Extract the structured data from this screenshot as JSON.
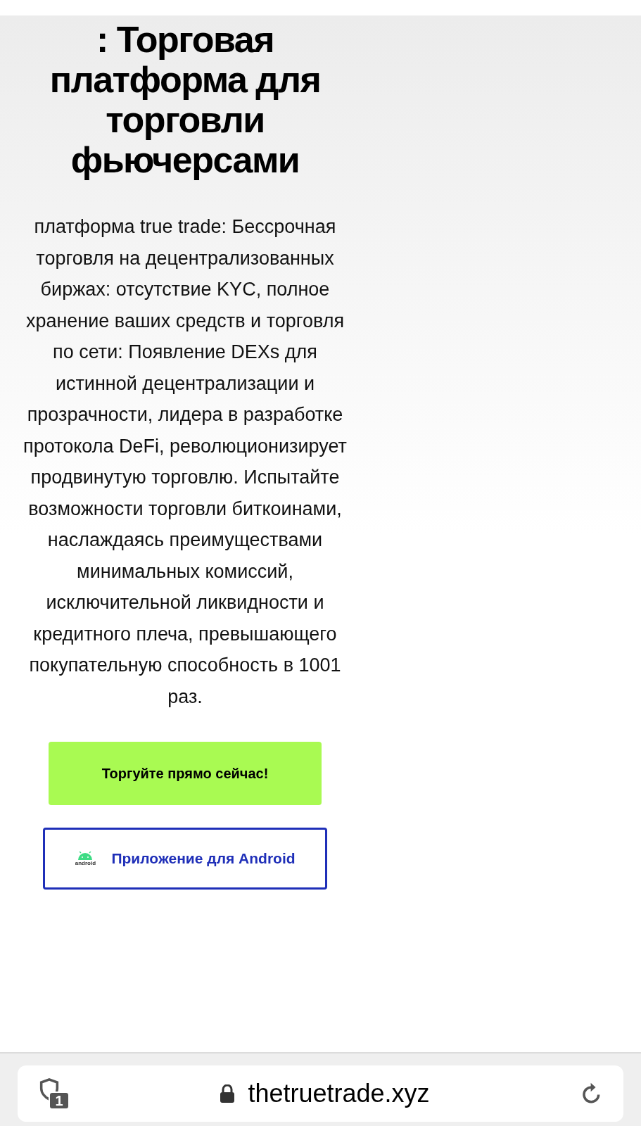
{
  "title": ": Торговая платформа для торговли фьючерсами",
  "description": "платформа true trade: Бессрочная торговля на децентрализованных биржах: отсутствие KYC, полное хранение ваших средств и торговля по сети: Появление DEXs для истинной децентрализации и прозрачности, лидера в разработке протокола DeFi, революционизирует продвинутую торговлю. Испытайте возможности торговли биткоинами, наслаждаясь преимуществами минимальных комиссий, исключительной ликвидности и кредитного плеча, превышающего покупательную способность в 1001 раз.",
  "buttons": [
    {
      "kind": "primary",
      "label": "Торгуйте прямо сейчас!"
    },
    {
      "kind": "android",
      "label": "Приложение для Android",
      "icon_caption": "android"
    }
  ],
  "address_bar": {
    "tab_count": "1",
    "url": "thetruetrade.xyz"
  }
}
